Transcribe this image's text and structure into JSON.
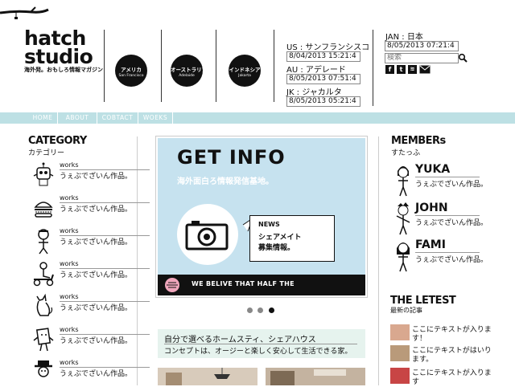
{
  "brand": {
    "logo_line1": "hatch",
    "logo_line2": "studio",
    "tagline": "海外発。おもしろ情報マガジン"
  },
  "regions": [
    {
      "jp": "アメリカ",
      "en": "San Francisco"
    },
    {
      "jp": "オーストラリア",
      "en": "Adelaide"
    },
    {
      "jp": "インドネシア",
      "en": "Jakarta"
    }
  ],
  "clocks": [
    {
      "label": "US : サンフランシスコ",
      "value": "8/04/2013 15:21:4"
    },
    {
      "label": "AU : アデレード",
      "value": "8/05/2013 07:51:4"
    },
    {
      "label": "JK : ジャカルタ",
      "value": "8/05/2013 05:21:4"
    }
  ],
  "japan_clock": {
    "label": "JAN : 日本",
    "value": "8/05/2013 07:21:4"
  },
  "search": {
    "placeholder": "検索"
  },
  "social": [
    "f",
    "t",
    "rss",
    "mail"
  ],
  "nav": [
    "HOME",
    "ABOUT",
    "COBTACT",
    "WOEKS"
  ],
  "category": {
    "title": "CATEGORY",
    "subtitle": "カテゴリー",
    "items": [
      {
        "tag": "works",
        "desc": "うぇぶでざいん作品。"
      },
      {
        "tag": "works",
        "desc": "うぇぶでざいん作品。"
      },
      {
        "tag": "works",
        "desc": "うぇぶでざいん作品。"
      },
      {
        "tag": "works",
        "desc": "うぇぶでざいん作品。"
      },
      {
        "tag": "works",
        "desc": "うぇぶでざいん作品。"
      },
      {
        "tag": "works",
        "desc": "うぇぶでざいん作品。"
      },
      {
        "tag": "works",
        "desc": "うぇぶでざいん作品。"
      }
    ]
  },
  "slider": {
    "title": "GET INFO",
    "subtitle": "海外面白ろ情報発信基地。",
    "news_label": "NEWS",
    "news_line1": "シェアメイト",
    "news_line2": "募集情報。",
    "bar_text": "WE BELIVE THAT HALF THE",
    "dots": 3,
    "active_dot": 3
  },
  "info": {
    "title": "自分で選べるホームスティ、シェアハウス",
    "desc": "コンセプトは、オージーと楽しく安心して生活できる家。"
  },
  "members": {
    "title": "MEMBERs",
    "subtitle": "すたっふ",
    "items": [
      {
        "name": "YUKA",
        "desc": "うぇぶでざいん作品。"
      },
      {
        "name": "JOHN",
        "desc": "うぇぶでざいん作品。"
      },
      {
        "name": "FAMI",
        "desc": "うぇぶでざいん作品。"
      }
    ]
  },
  "latest": {
    "title": "THE LETEST",
    "subtitle": "最新の記事",
    "posts": [
      "ここにテキストが入ります！",
      "ここにテキストがはいります。",
      "ここにテキストが入ります"
    ]
  },
  "colors": {
    "nav_bg": "#bde0e4",
    "slide_bg": "#c6e2ef",
    "info_bg": "#e6f3ee"
  }
}
